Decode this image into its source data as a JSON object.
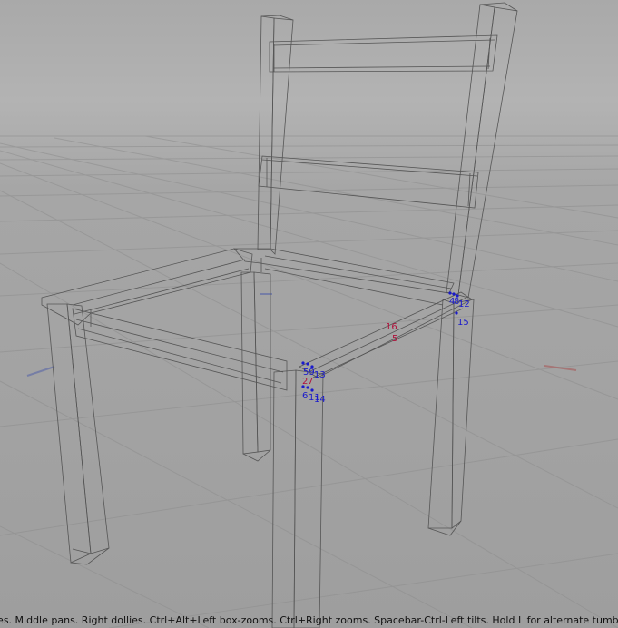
{
  "viewport": {
    "background_top": "#b3b3b3",
    "background_bottom": "#9e9e9e",
    "grid_color": "#8f8f8f",
    "wire_color": "#555555",
    "point_color": "#1a1acc",
    "selected_label_color": "#b0103a"
  },
  "point_labels": [
    {
      "text": "4",
      "color": "blue"
    },
    {
      "text": "8",
      "color": "blue"
    },
    {
      "text": "12",
      "color": "blue"
    },
    {
      "text": "15",
      "color": "blue"
    },
    {
      "text": "16",
      "color": "red"
    },
    {
      "text": "5",
      "color": "red"
    },
    {
      "text": "59",
      "color": "blue"
    },
    {
      "text": "13",
      "color": "blue"
    },
    {
      "text": "2",
      "color": "red"
    },
    {
      "text": "7",
      "color": "red"
    },
    {
      "text": "6",
      "color": "blue"
    },
    {
      "text": "11",
      "color": "blue"
    },
    {
      "text": "14",
      "color": "blue"
    }
  ],
  "status": {
    "text": "les. Middle pans. Right dollies. Ctrl+Alt+Left box-zooms. Ctrl+Right zooms. Spacebar-Ctrl-Left tilts. Hold L for alternate tumble, dolly, and zo"
  }
}
